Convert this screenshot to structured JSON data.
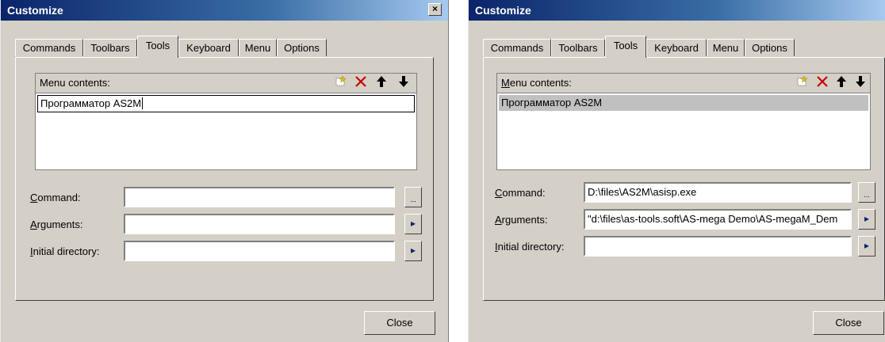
{
  "tab_labels": [
    "Commands",
    "Toolbars",
    "Tools",
    "Keyboard",
    "Menu",
    "Options"
  ],
  "active_tab": "Tools",
  "colors": {
    "title_bar": "#0a246a",
    "face": "#d4d0c8",
    "delete_icon": "#cc0000"
  },
  "icons": [
    "new-item-icon",
    "delete-icon",
    "move-up-icon",
    "move-down-icon",
    "ellipsis-icon",
    "arrow-right-icon"
  ],
  "left": {
    "title": "Customize",
    "close_x": "×",
    "menu_contents_label": "Menu contents:",
    "menu_item": "Программатор AS2M",
    "command_label": "Command:",
    "command_value": "",
    "arguments_label": "Arguments:",
    "arguments_value": "",
    "initial_dir_label": "Initial directory:",
    "initial_dir_value": "",
    "browse_label": "...",
    "arrow_label": "▸",
    "close_button": "Close"
  },
  "right": {
    "title": "Customize",
    "menu_contents_label": "Menu contents:",
    "menu_item": "Программатор AS2M",
    "command_label": "Command:",
    "command_value": "D:\\files\\AS2M\\asisp.exe",
    "arguments_label": "Arguments:",
    "arguments_value": "\"d:\\files\\as-tools.soft\\AS-mega Demo\\AS-megaM_Dem",
    "initial_dir_label": "Initial directory:",
    "initial_dir_value": "",
    "browse_label": "...",
    "arrow_label": "▸",
    "close_button": "Close"
  }
}
